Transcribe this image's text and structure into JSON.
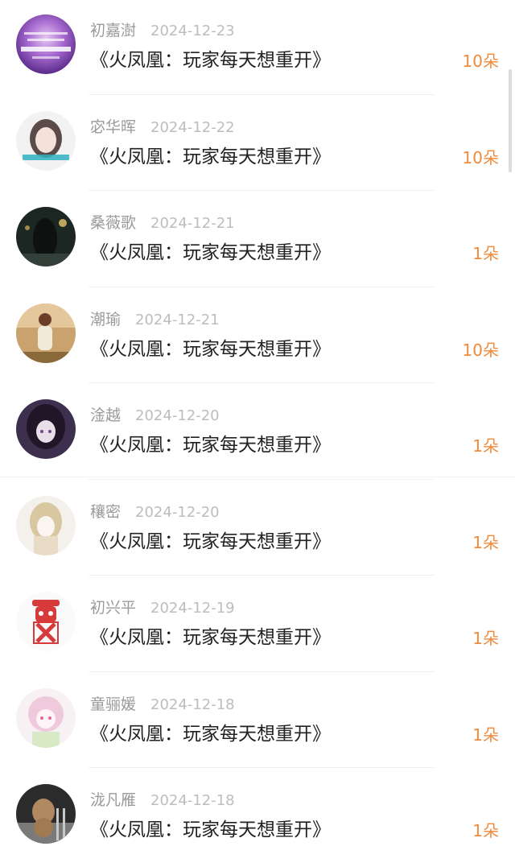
{
  "rows": [
    {
      "name": "初嘉澍",
      "date": "2024-12-23",
      "book": "《火凤凰：玩家每天想重开》",
      "gift": "10朵",
      "avatar_icon": "purple-text-avatar"
    },
    {
      "name": "宓华晖",
      "date": "2024-12-22",
      "book": "《火凤凰：玩家每天想重开》",
      "gift": "10朵",
      "avatar_icon": "girl-portrait-avatar"
    },
    {
      "name": "桑薇歌",
      "date": "2024-12-21",
      "book": "《火凤凰：玩家每天想重开》",
      "gift": "1朵",
      "avatar_icon": "dark-silhouette-avatar"
    },
    {
      "name": "潮瑜",
      "date": "2024-12-21",
      "book": "《火凤凰：玩家每天想重开》",
      "gift": "10朵",
      "avatar_icon": "woman-outdoor-avatar"
    },
    {
      "name": "淦越",
      "date": "2024-12-20",
      "book": "《火凤凰：玩家每天想重开》",
      "gift": "1朵",
      "avatar_icon": "anime-dark-avatar"
    },
    {
      "name": "穰密",
      "date": "2024-12-20",
      "book": "《火凤凰：玩家每天想重开》",
      "gift": "1朵",
      "avatar_icon": "anime-sketch-avatar"
    },
    {
      "name": "初兴平",
      "date": "2024-12-19",
      "book": "《火凤凰：玩家每天想重开》",
      "gift": "1朵",
      "avatar_icon": "red-skull-avatar"
    },
    {
      "name": "童骊媛",
      "date": "2024-12-18",
      "book": "《火凤凰：玩家每天想重开》",
      "gift": "1朵",
      "avatar_icon": "anime-pink-avatar"
    },
    {
      "name": "泷凡雁",
      "date": "2024-12-18",
      "book": "《火凤凰：玩家每天想重开》",
      "gift": "1朵",
      "avatar_icon": "dog-photo-avatar"
    }
  ],
  "colors": {
    "gift": "#f08a3c",
    "name": "#9a9a9a",
    "date": "#bdbdbd",
    "book": "#222222"
  }
}
